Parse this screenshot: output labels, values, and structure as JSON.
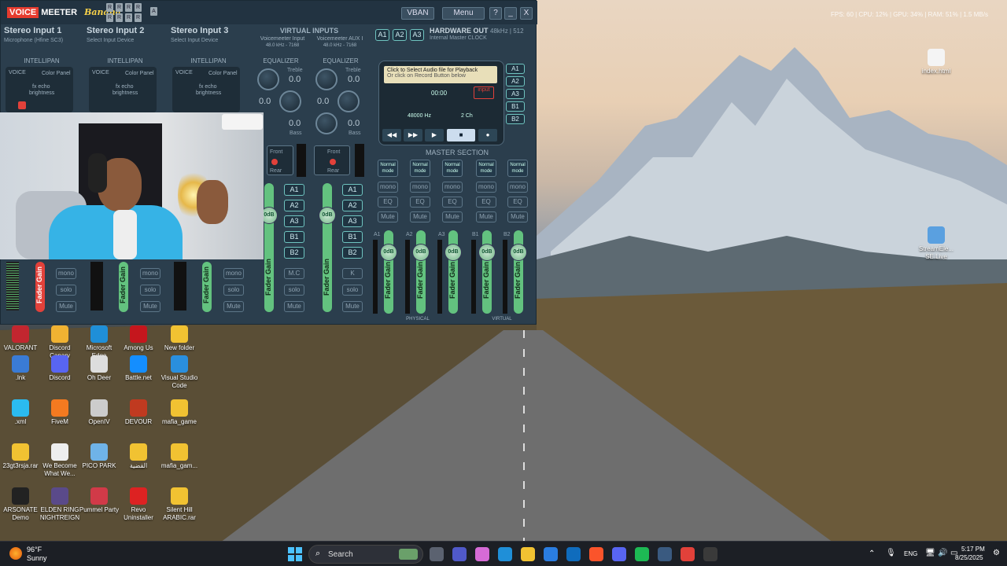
{
  "desktop": {
    "top_right_text": "FPS: 60 | CPU: 12% | GPU: 34% | RAM: 51% | 1.5 MB/s",
    "icons": [
      {
        "label": "VALORANT",
        "color": "#c2262f"
      },
      {
        "label": "Discord Canary",
        "color": "#f0b232"
      },
      {
        "label": "Microsoft Edge",
        "color": "#1f8fd8"
      },
      {
        "label": "Among Us",
        "color": "#c5161d"
      },
      {
        "label": "New folder",
        "color": "#f1c232"
      },
      {
        "label": ".lnk",
        "color": "#3a7bd5"
      },
      {
        "label": "Discord",
        "color": "#5865f2"
      },
      {
        "label": "Oh Deer",
        "color": "#dddddd"
      },
      {
        "label": "Battle.net",
        "color": "#148eff"
      },
      {
        "label": "Visual Studio Code",
        "color": "#2a8fde"
      },
      {
        "label": ".xml",
        "color": "#2bbbef"
      },
      {
        "label": "FiveM",
        "color": "#f47a20"
      },
      {
        "label": "OpenIV",
        "color": "#cccccc"
      },
      {
        "label": "DEVOUR",
        "color": "#c03a20"
      },
      {
        "label": "mafia_game",
        "color": "#f1c232"
      },
      {
        "label": "23gt3rsja.rar",
        "color": "#f1c232"
      },
      {
        "label": "We Become What We...",
        "color": "#eeeeee"
      },
      {
        "label": "PICO PARK",
        "color": "#6fb3e8"
      },
      {
        "label": "القضية",
        "color": "#f1c232"
      },
      {
        "label": "mafia_gam...",
        "color": "#f1c232"
      },
      {
        "label": "ARSONATE Demo",
        "color": "#222222"
      },
      {
        "label": "ELDEN RING NIGHTREIGN",
        "color": "#5a4a8a"
      },
      {
        "label": "Pummel Party",
        "color": "#d13a48"
      },
      {
        "label": "Revo Uninstaller",
        "color": "#d22"
      },
      {
        "label": "Silent Hill ARABIC.rar",
        "color": "#f1c232"
      }
    ],
    "right_icons": [
      {
        "label": "index.html"
      },
      {
        "label": "StreamEle... SE.Live"
      }
    ]
  },
  "voicemeeter": {
    "logo_voice": "VOICE",
    "logo_meeter": "MEETER",
    "logo_banana": "Banana",
    "vban": "VBAN",
    "menu": "Menu",
    "help": "?",
    "minimize": "_",
    "close": "X",
    "strips": [
      {
        "title": "Stereo Input 1",
        "device": "Microphone (Hfine SC3)"
      },
      {
        "title": "Stereo Input 2",
        "device": "Select Input Device"
      },
      {
        "title": "Stereo Input 3",
        "device": "Select Input Device"
      }
    ],
    "virtual_inputs": "VIRTUAL INPUTS",
    "vi1": "Voicemeeter Input",
    "vi2": "Voicemeeter AUX I",
    "vi_rate": "48.0 kHz - 7168",
    "hardware_out": "HARDWARE OUT",
    "hw_rate": "48kHz | 512",
    "hw_clock": "Internal Master CLOCK",
    "a1": "A1",
    "a2": "A2",
    "a3": "A3",
    "intellipan": "INTELLIPAN",
    "voice": "VOICE",
    "color_panel": "Color Panel",
    "fx_echo": "fx echo",
    "brightness": "brightness",
    "equalizer": "EQUALIZER",
    "treble": "Treble",
    "bass": "Bass",
    "eq_val": "0.0",
    "front": "Front",
    "rear": "Rear",
    "fader_gain": "Fader Gain",
    "db": "0dB",
    "mono": "mono",
    "solo": "solo",
    "mute": "Mute",
    "mc": "M.C",
    "k": "K",
    "b1": "B1",
    "b2": "B2",
    "tape_line1": "Click to Select Audio file for Playback",
    "tape_line2": "Or click on Record Button below",
    "tape_time": "00:00",
    "tape_input": "input",
    "tape_hz": "48000 Hz",
    "tape_ch": "2 Ch",
    "master_section": "MASTER SECTION",
    "normal_mode": "Normal mode",
    "eq": "EQ",
    "bus_labels": [
      "A1",
      "A2",
      "A3",
      "B1",
      "B2"
    ],
    "physical": "PHYSICAL",
    "virtual": "VIRTUAL"
  },
  "taskbar": {
    "weather_temp": "96°F",
    "weather_desc": "Sunny",
    "search_placeholder": "Search",
    "lang": "ENG",
    "time": "5:17 PM",
    "date": "8/25/2025"
  }
}
